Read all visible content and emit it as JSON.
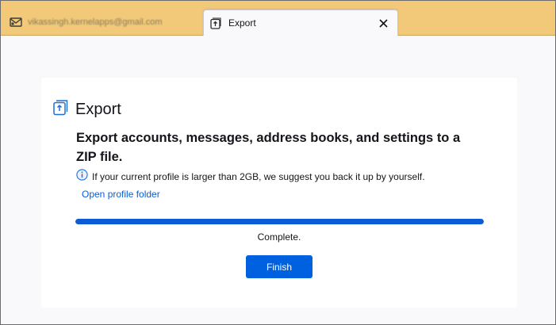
{
  "tabs": [
    {
      "label": "vikassingh.kernelapps@gmail.com",
      "icon": "mail-icon",
      "active": false
    },
    {
      "label": "Export",
      "icon": "export-icon",
      "active": true
    }
  ],
  "close_glyph": "✕",
  "export": {
    "title": "Export",
    "heading": "Export accounts, messages, address books, and settings to a ZIP file.",
    "info": "If your current profile is larger than 2GB, we suggest you back it up by yourself.",
    "link": "Open profile folder",
    "progress": 1.0,
    "status": "Complete.",
    "finish_label": "Finish"
  },
  "colors": {
    "tabbar_bg": "#f2c979",
    "accent": "#0061e0",
    "progress_fill": "#0b5cd6",
    "progress_track": "#d7d7db"
  }
}
